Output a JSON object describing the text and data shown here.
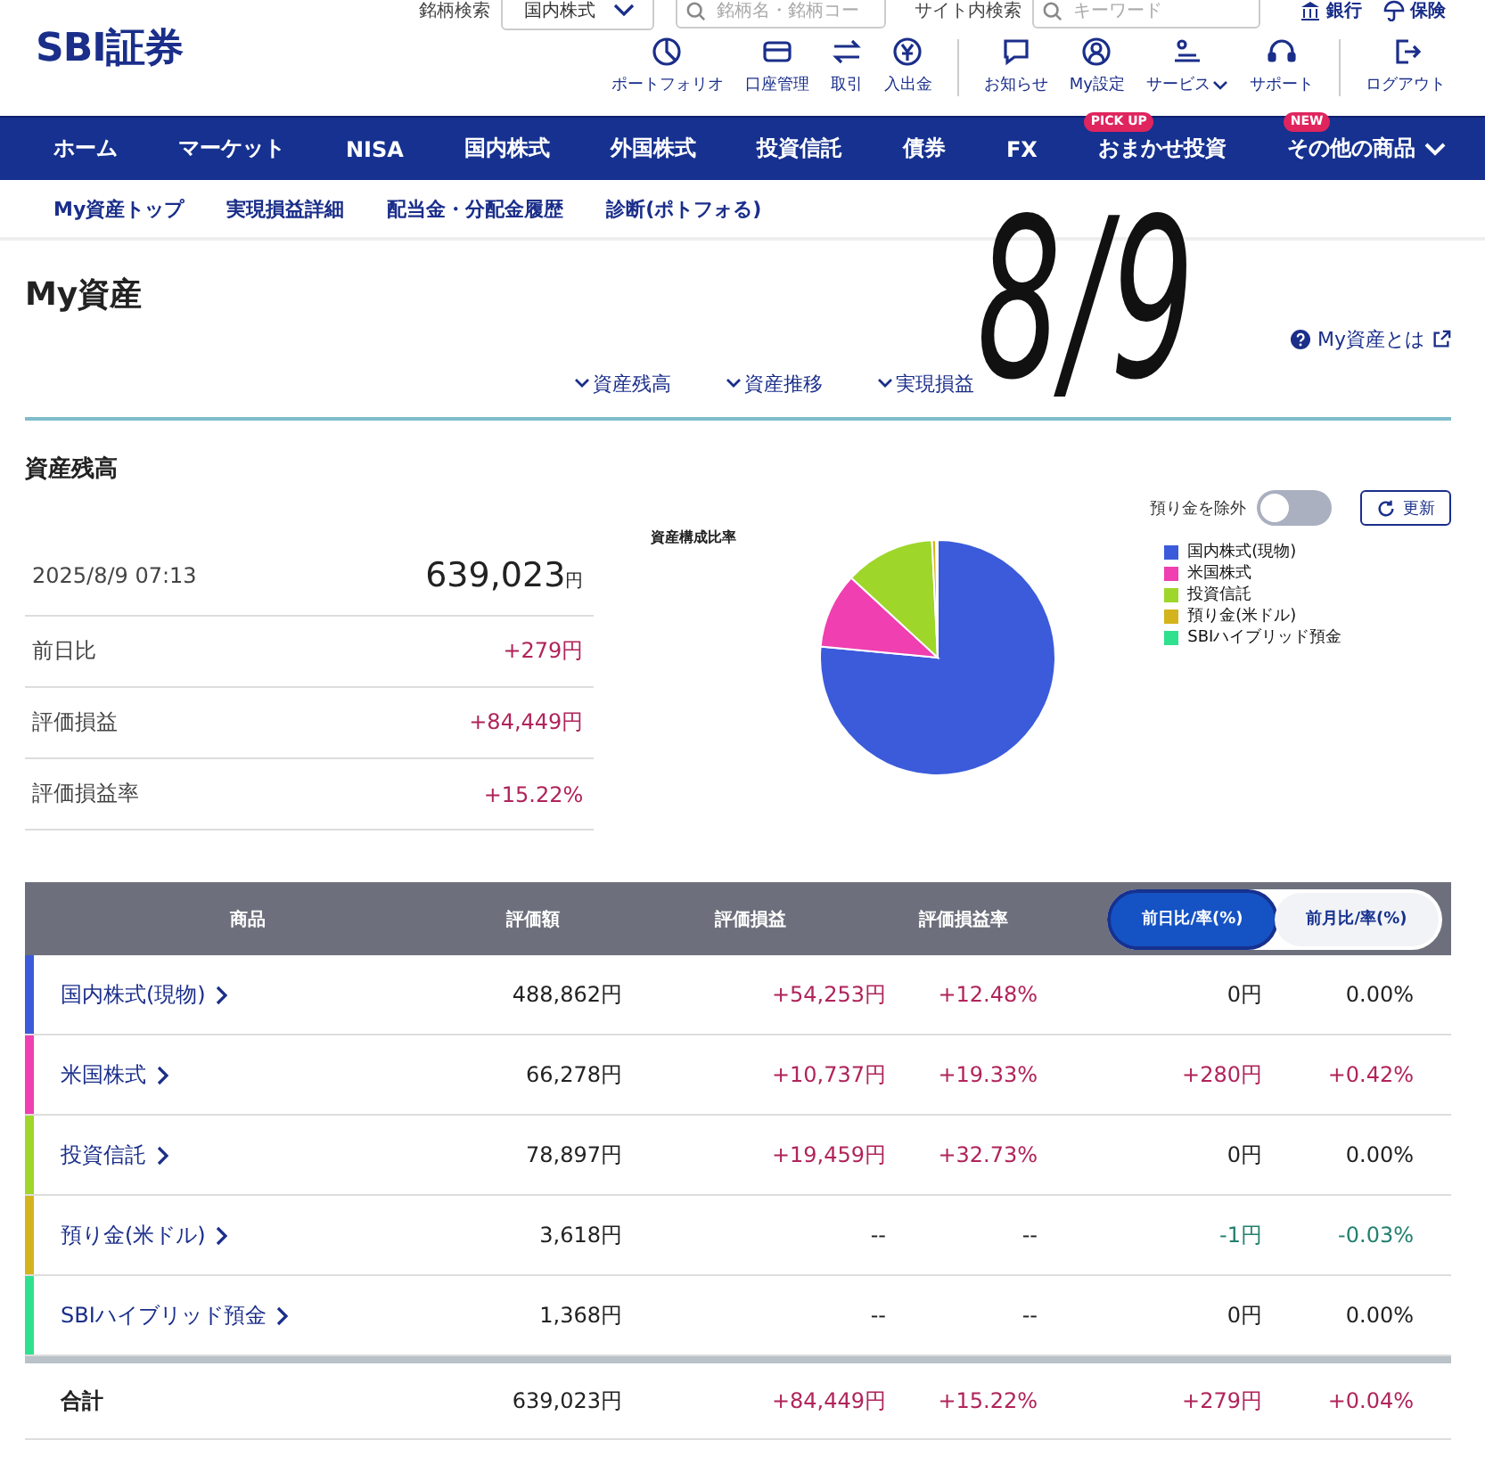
{
  "header": {
    "logo": "SBI証券",
    "search": {
      "label": "銘柄検索",
      "market": "国内株式",
      "placeholder": "銘柄名・銘柄コー"
    },
    "site_search": {
      "label": "サイト内検索",
      "placeholder": "キーワード"
    },
    "links": [
      {
        "label": "銀行"
      },
      {
        "label": "保険"
      }
    ],
    "tools": [
      {
        "label": "ポートフォリオ",
        "dropdown": false
      },
      {
        "label": "口座管理",
        "dropdown": false
      },
      {
        "label": "取引",
        "dropdown": false
      },
      {
        "label": "入出金",
        "dropdown": false
      },
      {
        "label": "お知らせ",
        "dropdown": false
      },
      {
        "label": "My設定",
        "dropdown": false
      },
      {
        "label": "サービス",
        "dropdown": true
      },
      {
        "label": "サポート",
        "dropdown": false
      },
      {
        "label": "ログアウト",
        "dropdown": false
      }
    ]
  },
  "nav": [
    {
      "label": "ホーム",
      "dropdown": false
    },
    {
      "label": "マーケット",
      "dropdown": false
    },
    {
      "label": "NISA",
      "dropdown": false
    },
    {
      "label": "国内株式",
      "dropdown": false
    },
    {
      "label": "外国株式",
      "dropdown": false
    },
    {
      "label": "投資信託",
      "dropdown": false
    },
    {
      "label": "債券",
      "dropdown": false
    },
    {
      "label": "FX",
      "dropdown": false
    },
    {
      "label": "おまかせ投資",
      "badge": "PICK UP",
      "dropdown": false
    },
    {
      "label": "その他の商品",
      "badge": "NEW",
      "dropdown": true
    }
  ],
  "subnav": [
    "My資産トップ",
    "実現損益詳細",
    "配当金・分配金履歴",
    "診断(ポトフォる)"
  ],
  "page_title": "My資産",
  "help_link": "My資産とは",
  "anchors": [
    "資産残高",
    "資産推移",
    "実現損益"
  ],
  "handwritten_note": "8/9",
  "section_title": "資産残高",
  "exclude_toggle": {
    "label": "預り金を除外",
    "on": false
  },
  "refresh_button": "更新",
  "summary": {
    "timestamp": "2025/8/9 07:13",
    "total": "639,023",
    "unit": "円",
    "rows": [
      {
        "label": "前日比",
        "value": {
          "text": "+279円",
          "color": "#b0245a"
        }
      },
      {
        "label": "評価損益",
        "value": {
          "text": "+84,449円",
          "color": "#b0245a"
        }
      },
      {
        "label": "評価損益率",
        "value": {
          "text": "+15.22%",
          "color": "#b0245a"
        }
      }
    ]
  },
  "chart_data": {
    "type": "pie",
    "title": "資産構成比率",
    "legend": "right",
    "categories": [
      "国内株式(現物)",
      "米国株式",
      "投資信託",
      "預り金(米ドル)",
      "SBIハイブリッド預金"
    ],
    "series": [
      {
        "colors": [
          "#3b5bdb",
          "#f03fb0",
          "#9ed62a",
          "#d4b41c",
          "#2fe08f"
        ],
        "values": [
          76.5,
          10.37,
          12.35,
          0.57,
          0.21
        ]
      }
    ]
  },
  "table": {
    "columns": [
      "商品",
      "評価額",
      "評価損益",
      "評価損益率"
    ],
    "compare_tabs": [
      {
        "label": "前日比/率(%)",
        "selected": true
      },
      {
        "label": "前月比/率(%)",
        "selected": false
      }
    ],
    "rows": [
      {
        "name": "国内株式(現物)",
        "color": "#3b5bdb",
        "value": "488,862円",
        "gain": {
          "text": "+54,253円",
          "color": "#b0245a"
        },
        "gain_rate": {
          "text": "+12.48%",
          "color": "#b0245a"
        },
        "change": {
          "text": "0円",
          "color": "#222222"
        },
        "change_rate": {
          "text": "0.00%",
          "color": "#222222"
        }
      },
      {
        "name": "米国株式",
        "color": "#f03fb0",
        "value": "66,278円",
        "gain": {
          "text": "+10,737円",
          "color": "#b0245a"
        },
        "gain_rate": {
          "text": "+19.33%",
          "color": "#b0245a"
        },
        "change": {
          "text": "+280円",
          "color": "#b0245a"
        },
        "change_rate": {
          "text": "+0.42%",
          "color": "#b0245a"
        }
      },
      {
        "name": "投資信託",
        "color": "#9ed62a",
        "value": "78,897円",
        "gain": {
          "text": "+19,459円",
          "color": "#b0245a"
        },
        "gain_rate": {
          "text": "+32.73%",
          "color": "#b0245a"
        },
        "change": {
          "text": "0円",
          "color": "#222222"
        },
        "change_rate": {
          "text": "0.00%",
          "color": "#222222"
        }
      },
      {
        "name": "預り金(米ドル)",
        "color": "#d4b41c",
        "value": "3,618円",
        "gain": {
          "text": "--",
          "color": "#222222"
        },
        "gain_rate": {
          "text": "--",
          "color": "#222222"
        },
        "change": {
          "text": "-1円",
          "color": "#23806e"
        },
        "change_rate": {
          "text": "-0.03%",
          "color": "#23806e"
        }
      },
      {
        "name": "SBIハイブリッド預金",
        "color": "#2fe08f",
        "value": "1,368円",
        "gain": {
          "text": "--",
          "color": "#222222"
        },
        "gain_rate": {
          "text": "--",
          "color": "#222222"
        },
        "change": {
          "text": "0円",
          "color": "#222222"
        },
        "change_rate": {
          "text": "0.00%",
          "color": "#222222"
        }
      }
    ],
    "total": {
      "name": "合計",
      "value": "639,023円",
      "gain": {
        "text": "+84,449円",
        "color": "#b0245a"
      },
      "gain_rate": {
        "text": "+15.22%",
        "color": "#b0245a"
      },
      "change": {
        "text": "+279円",
        "color": "#b0245a"
      },
      "change_rate": {
        "text": "+0.04%",
        "color": "#b0245a"
      }
    }
  }
}
